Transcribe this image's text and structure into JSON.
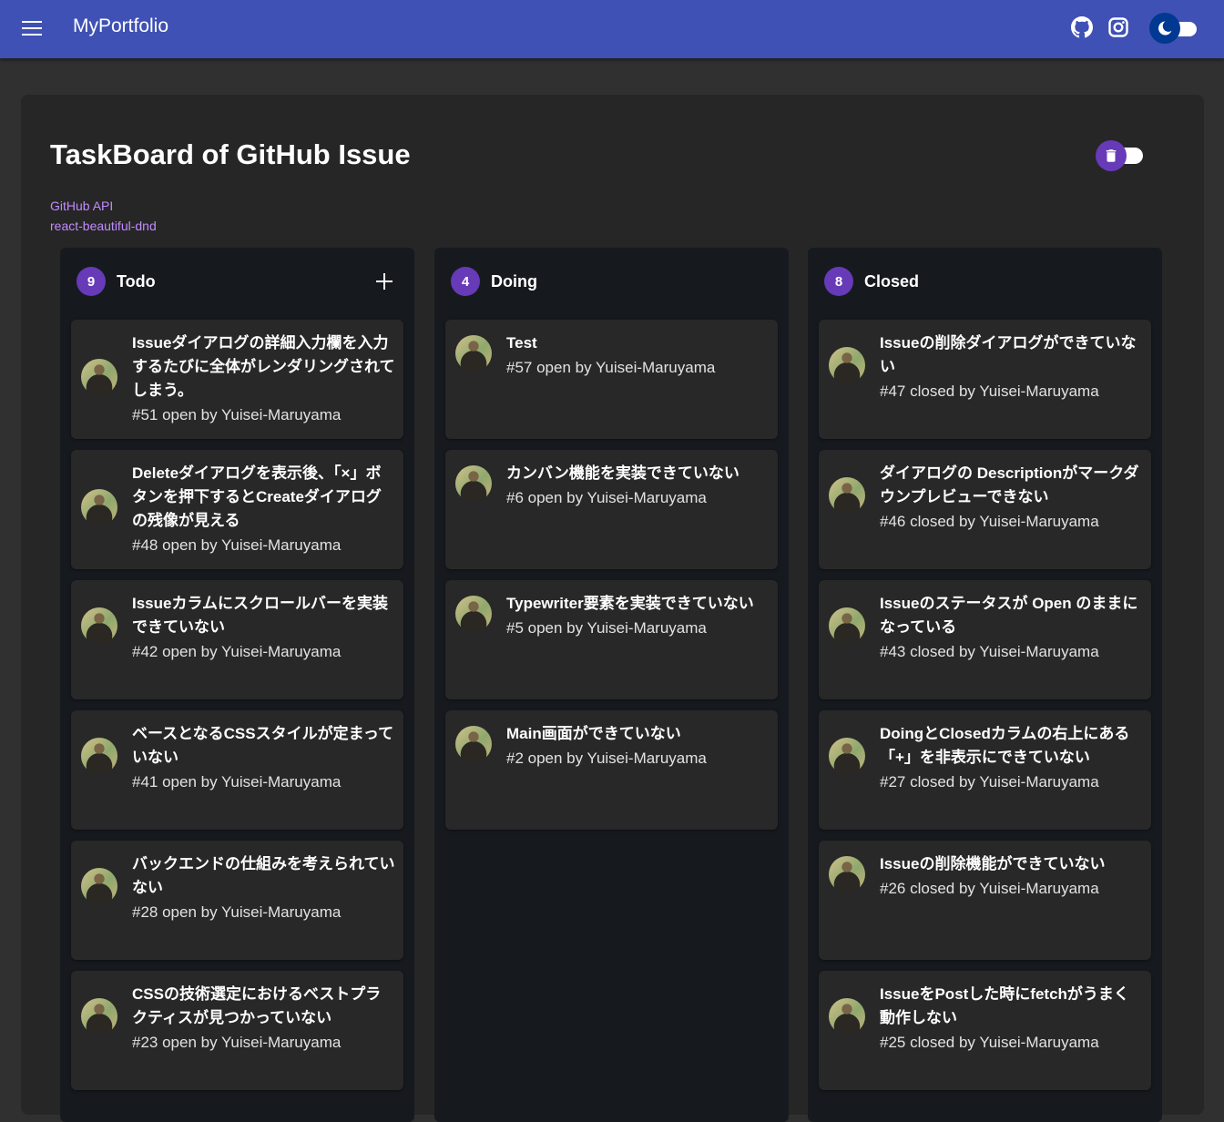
{
  "app": {
    "title": "MyPortfolio",
    "menu_icon": "menu-icon",
    "icons": [
      "github-icon",
      "instagram-icon",
      "dark-mode-toggle"
    ],
    "colors": {
      "appbar": "#3f51b5",
      "accent": "#673ab7",
      "link": "#c08bff",
      "background": "#303030"
    }
  },
  "page": {
    "title": "TaskBoard of GitHub Issue",
    "links": [
      "GitHub API",
      "react-beautiful-dnd"
    ],
    "delete_toggle_icon": "trash-icon"
  },
  "columns": [
    {
      "count": "9",
      "title": "Todo",
      "issues": [
        {
          "title": "Issueダイアログの詳細入力欄を入力するたびに全体がレンダリングされてしまう。",
          "meta": "#51 open by Yuisei-Maruyama"
        },
        {
          "title": "Deleteダイアログを表示後、「×」ボタンを押下するとCreateダイアログの残像が見える",
          "meta": "#48 open by Yuisei-Maruyama"
        },
        {
          "title": "Issueカラムにスクロールバーを実装できていない",
          "meta": "#42 open by Yuisei-Maruyama"
        },
        {
          "title": "ベースとなるCSSスタイルが定まっていない",
          "meta": "#41 open by Yuisei-Maruyama"
        },
        {
          "title": "バックエンドの仕組みを考えられていない",
          "meta": "#28 open by Yuisei-Maruyama"
        },
        {
          "title": "CSSの技術選定におけるベストプラクティスが見つかっていない",
          "meta": "#23 open by Yuisei-Maruyama"
        }
      ]
    },
    {
      "count": "4",
      "title": "Doing",
      "issues": [
        {
          "title": "Test",
          "meta": "#57 open by Yuisei-Maruyama"
        },
        {
          "title": "カンバン機能を実装できていない",
          "meta": "#6 open by Yuisei-Maruyama"
        },
        {
          "title": "Typewriter要素を実装できていない",
          "meta": "#5 open by Yuisei-Maruyama"
        },
        {
          "title": "Main画面ができていない",
          "meta": "#2 open by Yuisei-Maruyama"
        }
      ]
    },
    {
      "count": "8",
      "title": "Closed",
      "issues": [
        {
          "title": "Issueの削除ダイアログができていない",
          "meta": "#47 closed by Yuisei-Maruyama"
        },
        {
          "title": "ダイアログの Descriptionがマークダウンプレビューできない",
          "meta": "#46 closed by Yuisei-Maruyama"
        },
        {
          "title": "Issueのステータスが Open のままになっている",
          "meta": "#43 closed by Yuisei-Maruyama"
        },
        {
          "title": "DoingとClosedカラムの右上にある「+」を非表示にできていない",
          "meta": "#27 closed by Yuisei-Maruyama"
        },
        {
          "title": "Issueの削除機能ができていない",
          "meta": "#26 closed by Yuisei-Maruyama"
        },
        {
          "title": "IssueをPostした時にfetchがうまく動作しない",
          "meta": "#25 closed by Yuisei-Maruyama"
        }
      ]
    }
  ]
}
